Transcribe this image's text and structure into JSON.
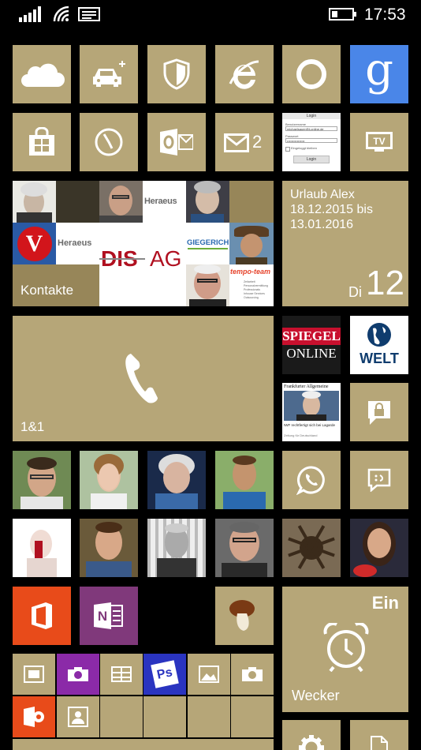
{
  "status_bar": {
    "time": "17:53",
    "signal_icon": "signal-bars-icon",
    "wifi_icon": "wifi-icon",
    "notification_icon": "message-icon",
    "battery_icon": "battery-icon"
  },
  "colors": {
    "accent": "#b6a678",
    "background": "#000000",
    "office_red": "#e84b1a",
    "onenote_purple": "#80397b",
    "google_blue": "#4a86e8",
    "ps_blue": "#2a34c0",
    "camera_purple": "#8b2aa8"
  },
  "tiles": {
    "onedrive": {
      "icon": "cloud-icon"
    },
    "car": {
      "icon": "car-icon"
    },
    "shield": {
      "icon": "shield-icon"
    },
    "ie": {
      "icon": "internet-explorer-icon"
    },
    "cortana": {
      "icon": "cortana-icon"
    },
    "google": {
      "icon": "google-icon",
      "letter": "g"
    },
    "store": {
      "icon": "store-icon"
    },
    "clock_nav": {
      "icon": "compass-icon"
    },
    "outlook": {
      "icon": "outlook-icon"
    },
    "mail": {
      "icon": "mail-icon",
      "count": "2"
    },
    "login": {
      "title": "Login",
      "field1": "Benutzername",
      "value1": "michaelsauer@t-online.de",
      "field2": "Passwort",
      "value2": "••••••••••••••••",
      "remember": "Eingeloggt bleiben",
      "button": "Login"
    },
    "tv": {
      "icon": "tv-icon",
      "label": "TV"
    },
    "contacts": {
      "label": "Kontakte",
      "logos": {
        "heraeus": "Heraeus",
        "giegerich": "GIEGERICH",
        "dis": "DIS",
        "ag": "AG",
        "tempo": "tempo-team",
        "tempo_lines": [
          "Zeitarbeit",
          "Personalvermittlung",
          "Professionals",
          "Inhouse Services",
          "Outsourcing"
        ]
      }
    },
    "calendar": {
      "line1": "Urlaub Alex",
      "line2": "18.12.2015 bis",
      "line3": "13.01.2016",
      "weekday": "Di",
      "day": "12"
    },
    "phone": {
      "label": "1&1",
      "icon": "phone-icon"
    },
    "spiegel": {
      "top": "SPIEGEL",
      "bottom": "ONLINE"
    },
    "welt": {
      "label": "WELT",
      "icon": "globe-icon"
    },
    "faz": {
      "masthead": "Frankfurter Allgemeine",
      "headline": "IWF rechtfertigt sich bei Lagarde",
      "sub": "Zeitung für Deutschland"
    },
    "chat_lock": {
      "icon": "chat-lock-icon"
    },
    "whatsapp": {
      "icon": "whatsapp-icon"
    },
    "messaging": {
      "icon": "messaging-icon"
    },
    "office": {
      "icon": "office-icon"
    },
    "onenote": {
      "icon": "onenote-icon",
      "letter": "N"
    },
    "mushroom": {
      "icon": "mushroom-icon"
    },
    "alarm": {
      "label": "Wecker",
      "status": "Ein",
      "icon": "alarm-clock-icon"
    },
    "small_tiles": [
      {
        "name": "photo-frame",
        "icon": "photo-frame-icon"
      },
      {
        "name": "camera-purple",
        "icon": "camera-icon"
      },
      {
        "name": "table-app",
        "icon": "table-icon"
      },
      {
        "name": "photoshop",
        "icon": "photoshop-icon",
        "letter": "Ps"
      },
      {
        "name": "image-app",
        "icon": "image-icon"
      },
      {
        "name": "camera",
        "icon": "camera-icon"
      },
      {
        "name": "office-lens",
        "icon": "office-lens-icon"
      },
      {
        "name": "contact-card",
        "icon": "contact-card-icon"
      }
    ],
    "settings": {
      "icon": "gear-icon"
    },
    "document": {
      "icon": "document-icon"
    }
  }
}
